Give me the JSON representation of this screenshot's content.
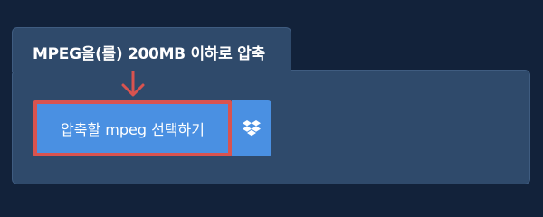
{
  "section": {
    "title": "MPEG을(를) 200MB 이하로 압축"
  },
  "upload": {
    "button_label": "압축할 mpeg 선택하기",
    "dropbox_icon": "dropbox-icon"
  },
  "colors": {
    "background": "#12223a",
    "panel": "#2f4a6b",
    "button": "#4a90e2",
    "highlight": "#d9534f"
  }
}
